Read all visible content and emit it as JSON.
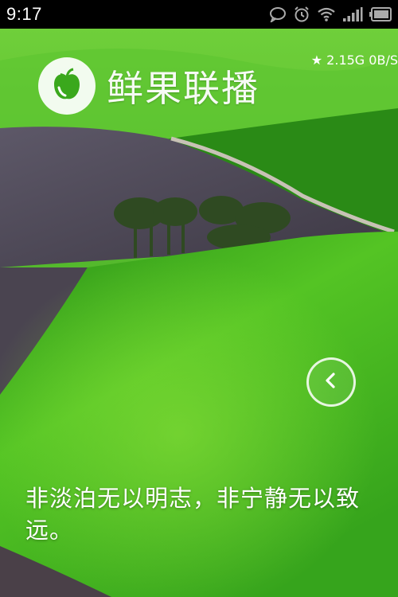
{
  "status_bar": {
    "time": "9:17",
    "icons": [
      "chat-bubble-icon",
      "alarm-icon",
      "wifi-icon",
      "signal-icon",
      "battery-icon"
    ]
  },
  "app": {
    "title": "鲜果联播",
    "logo_icon": "fruit-logo-icon"
  },
  "net_speed": "★ 2.15G  0B/S",
  "slide": {
    "quote": "非淡泊无以明志，非宁静无以致远。",
    "next_button_icon": "chevron-left-icon"
  },
  "colors": {
    "field_green": "#3cae1c",
    "field_bright": "#6bd52a",
    "soil": "#4a4550",
    "status_bar": "#000000"
  }
}
